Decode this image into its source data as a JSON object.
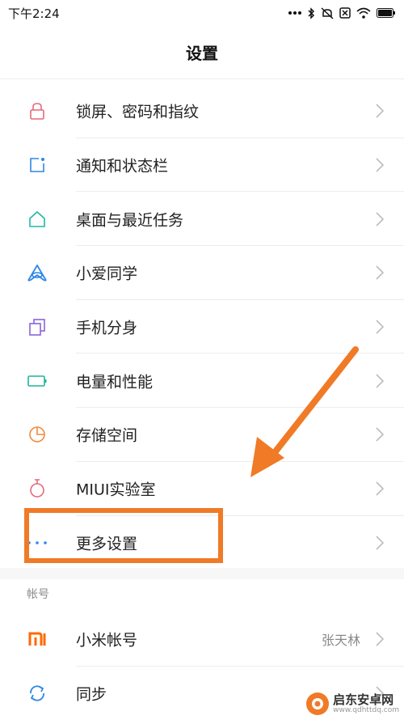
{
  "status_bar": {
    "time": "下午2:24",
    "icons": [
      "dots-icon",
      "bluetooth-icon",
      "mute-icon",
      "sim-off-icon",
      "wifi-icon",
      "battery-icon"
    ]
  },
  "header": {
    "title": "设置"
  },
  "settings": [
    {
      "label": "锁屏、密码和指纹",
      "icon": "lock-icon",
      "color": "#e46a78"
    },
    {
      "label": "通知和状态栏",
      "icon": "notification-icon",
      "color": "#2f87e6"
    },
    {
      "label": "桌面与最近任务",
      "icon": "home-icon",
      "color": "#21b8a8"
    },
    {
      "label": "小爱同学",
      "icon": "xiaoai-icon",
      "color": "#2f87e6"
    },
    {
      "label": "手机分身",
      "icon": "second-space-icon",
      "color": "#8a64d6"
    },
    {
      "label": "电量和性能",
      "icon": "battery-performance-icon",
      "color": "#1fb59a"
    },
    {
      "label": "存储空间",
      "icon": "storage-icon",
      "color": "#f08a3c"
    },
    {
      "label": "MIUI实验室",
      "icon": "lab-flask-icon",
      "color": "#e46a78"
    },
    {
      "label": "更多设置",
      "icon": "more-dots-icon",
      "color": "#2f87e6"
    }
  ],
  "account_section": {
    "title": "帐号",
    "items": [
      {
        "label": "小米帐号",
        "value": "张天林",
        "icon": "mi-logo-icon",
        "color": "#ff6a00"
      },
      {
        "label": "同步",
        "icon": "sync-icon",
        "color": "#2f87e6"
      }
    ]
  },
  "annotation": {
    "color": "#f07a26"
  },
  "watermark": {
    "text": "启东安卓网",
    "url": "www.qdhttdq.com"
  }
}
